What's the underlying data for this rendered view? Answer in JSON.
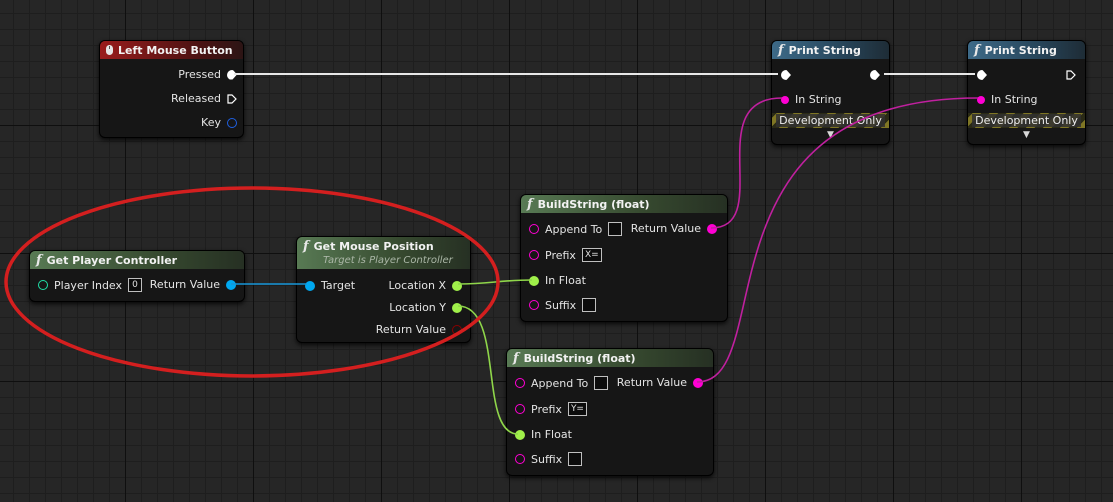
{
  "nodes": {
    "left_mouse_button": {
      "title": "Left Mouse Button",
      "pins": {
        "pressed": "Pressed",
        "released": "Released",
        "key": "Key"
      }
    },
    "print_string_1": {
      "title": "Print String",
      "in_string": "In String",
      "development_only": "Development Only"
    },
    "print_string_2": {
      "title": "Print String",
      "in_string": "In String",
      "development_only": "Development Only"
    },
    "get_player_controller": {
      "title": "Get Player Controller",
      "player_index_label": "Player Index",
      "player_index_value": "0",
      "return_value": "Return Value"
    },
    "get_mouse_position": {
      "title": "Get Mouse Position",
      "subtitle": "Target is Player Controller",
      "target": "Target",
      "location_x": "Location X",
      "location_y": "Location Y",
      "return_value": "Return Value"
    },
    "build_string_1": {
      "title": "BuildString (float)",
      "append_to": "Append To",
      "prefix": "Prefix",
      "prefix_value": "X=",
      "in_float": "In Float",
      "suffix": "Suffix",
      "return_value": "Return Value"
    },
    "build_string_2": {
      "title": "BuildString (float)",
      "append_to": "Append To",
      "prefix": "Prefix",
      "prefix_value": "Y=",
      "in_float": "In Float",
      "suffix": "Suffix",
      "return_value": "Return Value"
    }
  },
  "colors": {
    "exec_wire": "#ffffff",
    "string_pin": "#ff00d4",
    "float_pin": "#a0f04a",
    "object_pin": "#00a8f0",
    "int_pin": "#1fe0a8",
    "key_pin": "#1f5fe0",
    "bool_pin": "#8a0000",
    "annotation": "#d41f1f"
  },
  "icons": {
    "event": "mouse-icon",
    "function": "function-f-icon",
    "expand": "chevron-down-icon"
  }
}
